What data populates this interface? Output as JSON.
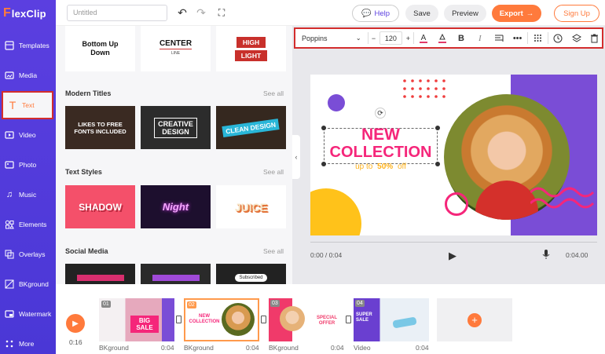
{
  "app": {
    "logo_mark": "F",
    "logo_text": "lexClip"
  },
  "header": {
    "title_placeholder": "Untitled",
    "help_label": "Help",
    "save_label": "Save",
    "preview_label": "Preview",
    "export_label": "Export",
    "signup_label": "Sign Up"
  },
  "sidebar": {
    "items": [
      {
        "label": "Templates"
      },
      {
        "label": "Media"
      },
      {
        "label": "Text"
      },
      {
        "label": "Video"
      },
      {
        "label": "Photo"
      },
      {
        "label": "Music"
      },
      {
        "label": "Elements"
      },
      {
        "label": "Overlays"
      },
      {
        "label": "BKground"
      },
      {
        "label": "Watermark"
      },
      {
        "label": "More"
      }
    ]
  },
  "panel": {
    "top_tiles": [
      {
        "line1": "Bottom Up",
        "line2": "Down"
      },
      {
        "line1": "CENTER",
        "line2": "LINE"
      },
      {
        "line1": "HIGH",
        "line2": "LIGHT"
      }
    ],
    "sections": [
      {
        "title": "Modern Titles",
        "see_all": "See all",
        "tiles": [
          {
            "line1": "LIKES TO FREE",
            "line2": "FONTS INCLUDED"
          },
          {
            "line1": "CREATIVE",
            "line2": "DESIGN"
          },
          {
            "line1": "CLEAN DESIGN",
            "line2": ""
          }
        ]
      },
      {
        "title": "Text Styles",
        "see_all": "See all",
        "tiles": [
          {
            "line1": "SHADOW"
          },
          {
            "line1": "Night"
          },
          {
            "line1": "JUICE"
          }
        ]
      },
      {
        "title": "Social Media",
        "see_all": "See all",
        "tiles": [
          {
            "line1": ""
          },
          {
            "line1": ""
          },
          {
            "line1": "Subscribed"
          }
        ]
      }
    ]
  },
  "toolbar": {
    "font": "Poppins",
    "font_size": "120",
    "minus": "−",
    "plus": "+",
    "icons": [
      "text-color-icon",
      "highlight-icon",
      "bold-icon",
      "italic-icon",
      "align-icon",
      "more-icon",
      "grid-icon",
      "clock-icon",
      "layers-icon",
      "trash-icon"
    ]
  },
  "stage": {
    "headline1": "NEW",
    "headline2": "COLLECTION",
    "sub_prefix": "up to",
    "sub_value": "50%",
    "sub_suffix": "off",
    "colors": {
      "pink": "#f5267a",
      "purple": "#7a4dd6",
      "yellow": "#ffc21a",
      "red": "#ef3c3c"
    }
  },
  "player": {
    "current": "0:00 / 0:04",
    "total": "0:04.00"
  },
  "timeline": {
    "play_time": "0:16",
    "clips": [
      {
        "num": "01",
        "title": "BIG SALE",
        "type": "BKground",
        "duration": "0:04"
      },
      {
        "num": "02",
        "title": "NEW COLLECTION",
        "type": "BKground",
        "duration": "0:04"
      },
      {
        "num": "03",
        "title": "SPECIAL OFFER",
        "type": "BKground",
        "duration": "0:04"
      },
      {
        "num": "04",
        "title": "SUPER SALE",
        "type": "Video",
        "duration": "0:04"
      }
    ],
    "add_label": "+"
  }
}
